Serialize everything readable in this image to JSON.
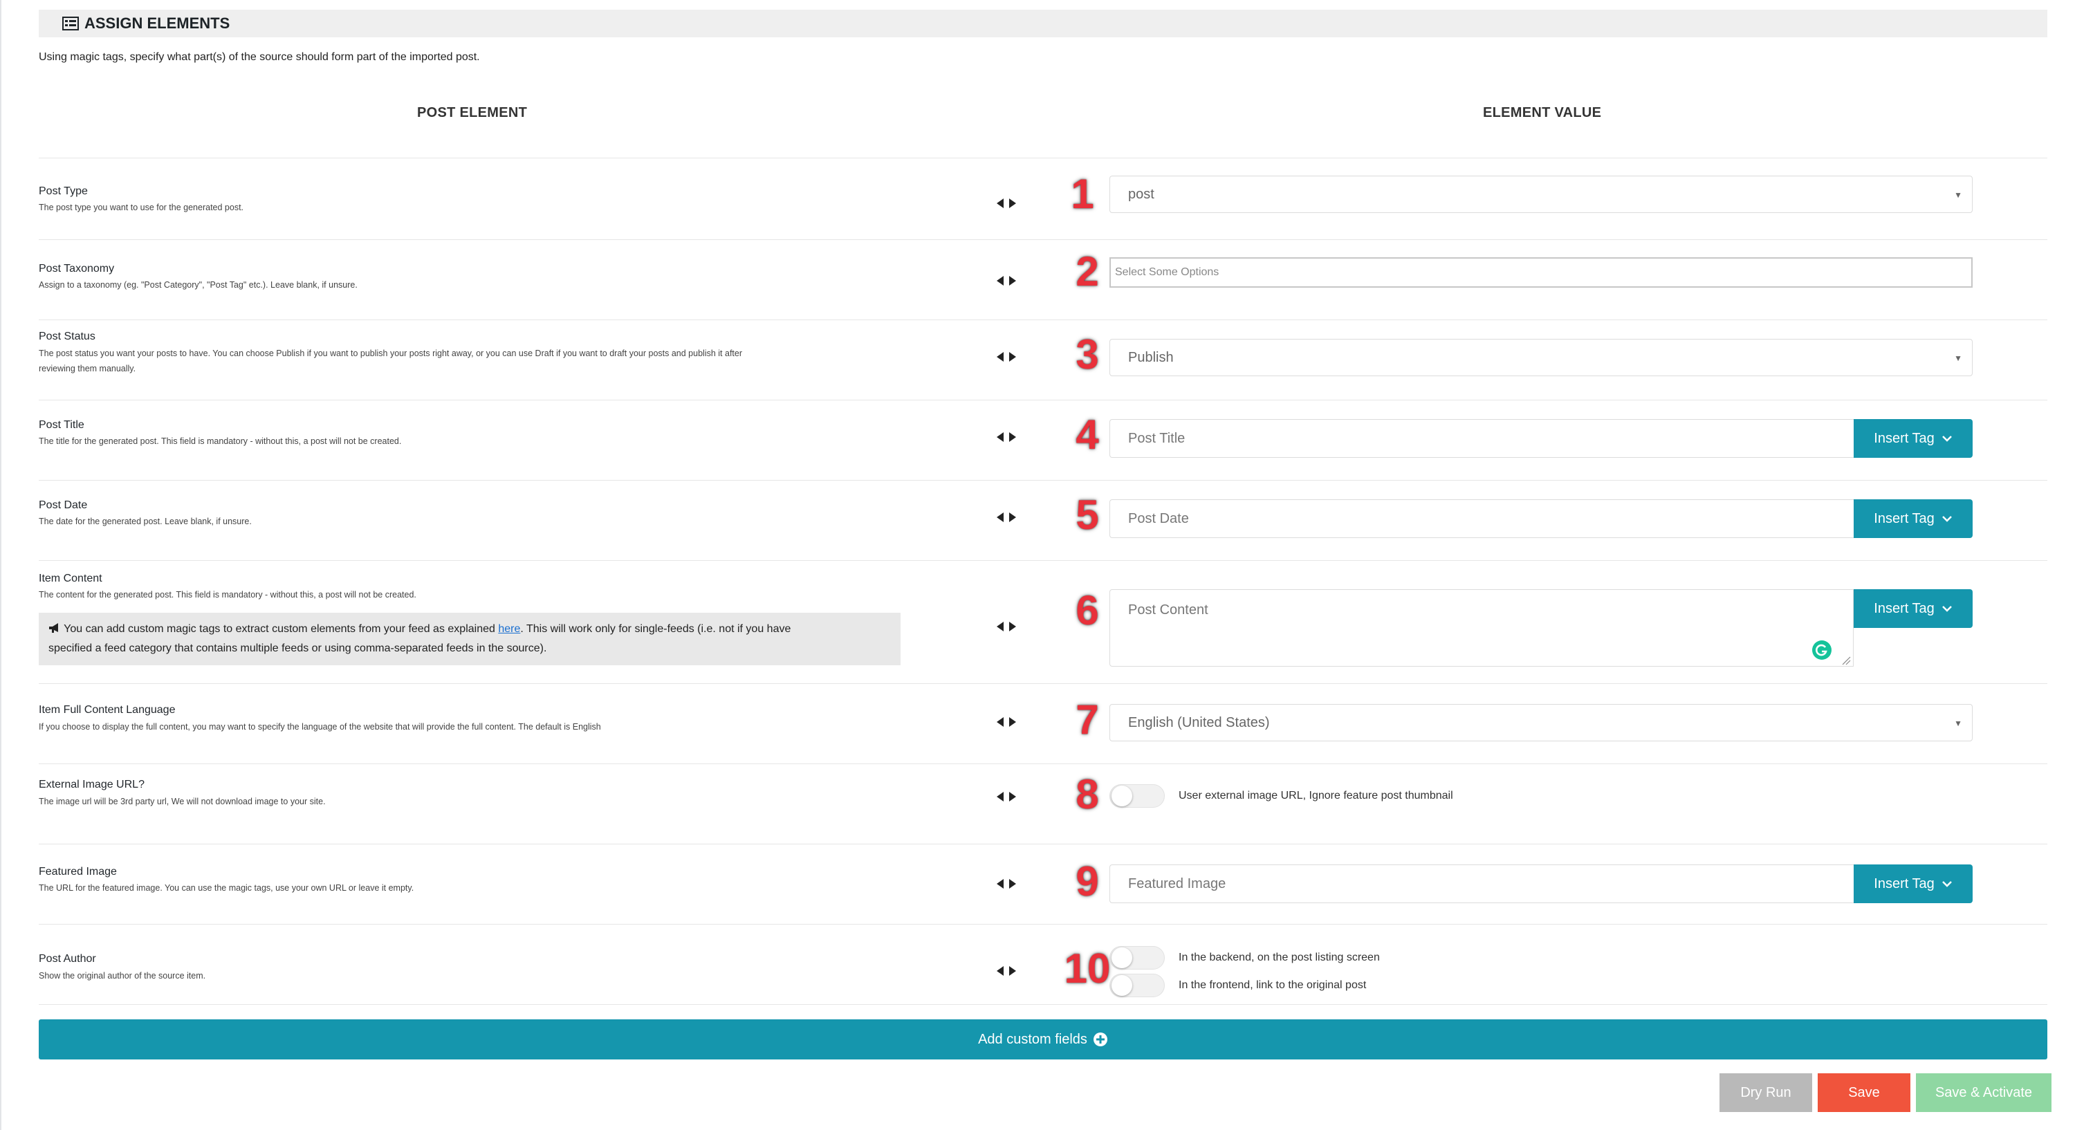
{
  "section": {
    "title": "ASSIGN ELEMENTS",
    "icon": "list-icon",
    "intro": "Using magic tags, specify what part(s) of the source should form part of the imported post."
  },
  "columns": {
    "left": "POST ELEMENT",
    "right": "ELEMENT VALUE"
  },
  "rows": {
    "post_type": {
      "number": "1",
      "title": "Post Type",
      "desc": "The post type you want to use for the generated post.",
      "value": "post"
    },
    "post_taxonomy": {
      "number": "2",
      "title": "Post Taxonomy",
      "desc": "Assign to a taxonomy (eg. \"Post Category\", \"Post Tag\" etc.). Leave blank, if unsure.",
      "placeholder": "Select Some Options"
    },
    "post_status": {
      "number": "3",
      "title": "Post Status",
      "desc1": "The post status you want your posts to have. You can choose Publish if you want to publish your posts right away, or you can use Draft if you want to draft your posts and publish it after",
      "desc2": "reviewing them manually.",
      "value": "Publish"
    },
    "post_title": {
      "number": "4",
      "title": "Post Title",
      "desc": "The title for the generated post. This field is mandatory - without this, a post will not be created.",
      "placeholder": "Post Title"
    },
    "post_date": {
      "number": "5",
      "title": "Post Date",
      "desc": "The date for the generated post. Leave blank, if unsure.",
      "placeholder": "Post Date"
    },
    "item_content": {
      "number": "6",
      "title": "Item Content",
      "desc": "The content for the generated post. This field is mandatory - without this, a post will not be created.",
      "placeholder": "Post Content",
      "notice_pre": "You can add custom magic tags to extract custom elements from your feed as explained ",
      "notice_link": "here",
      "notice_post1": ". This will work only for single-feeds (i.e. not if you have",
      "notice_post2": "specified a feed category that contains multiple feeds or using comma-separated feeds in the source)."
    },
    "language": {
      "number": "7",
      "title": "Item Full Content Language",
      "desc": "If you choose to display the full content, you may want to specify the language of the website that will provide the full content. The default is English",
      "value": "English (United States)"
    },
    "external_image": {
      "number": "8",
      "title": "External Image URL?",
      "desc": "The image url will be 3rd party url, We will not download image to your site.",
      "toggle_label": "User external image URL, Ignore feature post thumbnail",
      "toggle_on": false
    },
    "featured_image": {
      "number": "9",
      "title": "Featured Image",
      "desc": "The URL for the featured image. You can use the magic tags, use your own URL or leave it empty.",
      "placeholder": "Featured Image"
    },
    "post_author": {
      "number": "10",
      "title": "Post Author",
      "desc": "Show the original author of the source item.",
      "toggle1_label": "In the backend, on the post listing screen",
      "toggle2_label": "In the frontend, link to the original post",
      "toggle1_on": false,
      "toggle2_on": false
    }
  },
  "insert_tag_label": "Insert Tag",
  "add_custom_fields_label": "Add custom fields",
  "buttons": {
    "dry_run": "Dry Run",
    "save": "Save",
    "save_activate": "Save & Activate"
  },
  "colors": {
    "teal": "#1596ad",
    "save_red": "#f0543c",
    "dry_run_gray": "#b9b9b9",
    "activate_green": "#8fd7a2",
    "annotation_red": "#e8303a"
  }
}
